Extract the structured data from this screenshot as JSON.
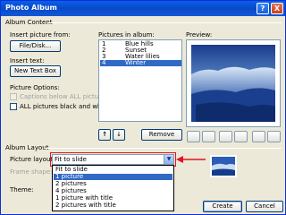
{
  "window": {
    "title": "Photo Album",
    "help_label": "?",
    "close_label": "X"
  },
  "album_content": {
    "group_label": "Album Content",
    "insert_picture_label": "Insert picture from:",
    "file_disk_button": "File/Disk...",
    "insert_text_label": "Insert text:",
    "new_text_box_button": "New Text Box",
    "picture_options_label": "Picture Options:",
    "captions_option": "Captions below ALL pictures",
    "black_white_option": "ALL pictures black and white",
    "pictures_in_album_label": "Pictures in album:",
    "pictures": [
      {
        "num": "1",
        "name": "Blue hills",
        "selected": false
      },
      {
        "num": "2",
        "name": "Sunset",
        "selected": false
      },
      {
        "num": "3",
        "name": "Water lilies",
        "selected": false
      },
      {
        "num": "4",
        "name": "Winter",
        "selected": true
      }
    ],
    "move_up_label": "↑",
    "move_down_label": "↓",
    "remove_button": "Remove",
    "preview_label": "Preview:"
  },
  "album_layout": {
    "group_label": "Album Layout",
    "picture_layout_label": "Picture layout:",
    "picture_layout_value": "Fit to slide",
    "frame_shape_label": "Frame shape:",
    "theme_label": "Theme:",
    "layout_options": [
      {
        "label": "Fit to slide",
        "selected": false
      },
      {
        "label": "1 picture",
        "selected": true
      },
      {
        "label": "2 pictures",
        "selected": false
      },
      {
        "label": "4 pictures",
        "selected": false
      },
      {
        "label": "1 picture with title",
        "selected": false
      },
      {
        "label": "2 pictures with title",
        "selected": false
      }
    ]
  },
  "footer": {
    "create_button": "Create",
    "cancel_button": "Cancel"
  },
  "colors": {
    "selection": "#316ac5",
    "highlight_box": "#e0141e",
    "title_bar": "#0a5fe9"
  }
}
